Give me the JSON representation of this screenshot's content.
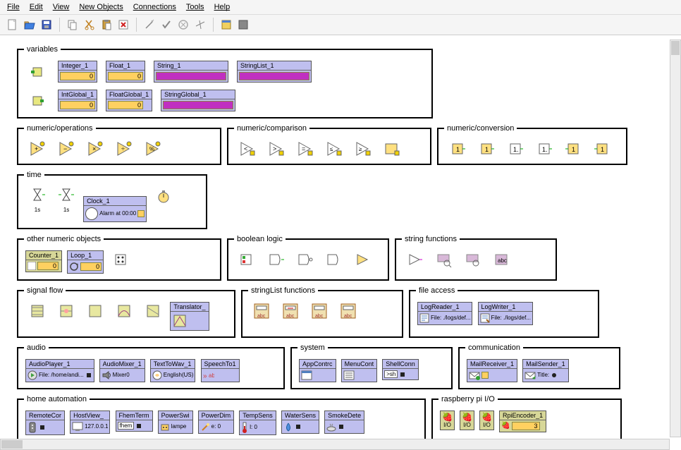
{
  "menu": {
    "file": "File",
    "edit": "Edit",
    "view": "View",
    "newobj": "New Objects",
    "conn": "Connections",
    "tools": "Tools",
    "help": "Help"
  },
  "groups": {
    "variables": "variables",
    "numops": "numeric/operations",
    "numcmp": "numeric/comparison",
    "numconv": "numeric/conversion",
    "time": "time",
    "othernum": "other numeric objects",
    "boollogic": "boolean logic",
    "stringfn": "string functions",
    "signalflow": "signal flow",
    "strlistfn": "stringList functions",
    "fileaccess": "file access",
    "audio": "audio",
    "system": "system",
    "comm": "communication",
    "homeauto": "home automation",
    "rpio": "raspberry pi I/O"
  },
  "v": {
    "integer": "Integer_1",
    "integer_v": "0",
    "float": "Float_1",
    "float_v": "0",
    "string": "String_1",
    "stringlist": "StringList_1",
    "intglobal": "IntGlobal_1",
    "intglobal_v": "0",
    "floatglobal": "FloatGlobal_1",
    "floatglobal_v": "0",
    "stringglobal": "StringGlobal_1"
  },
  "time": {
    "clock": "Clock_1",
    "alarm": "Alarm at 00:00",
    "onesec1": "1s",
    "onesec2": "1s"
  },
  "othernum": {
    "counter": "Counter_1",
    "counter_v": "0",
    "loop": "Loop_1",
    "loop_v": "0"
  },
  "signalflow": {
    "translator": "Translator_"
  },
  "fileaccess": {
    "logreader": "LogReader_1",
    "logreader_s": "File: ./logs/def...",
    "logwriter": "LogWriter_1",
    "logwriter_s": "File: ./logs/def..."
  },
  "audio": {
    "player": "AudioPlayer_1",
    "player_s": "File: /home/andi...",
    "mixer": "AudioMixer_1",
    "mixer_s": "Mixer0",
    "tts": "TextToWav_1",
    "tts_s": "English(US)",
    "stt": "SpeechTo1"
  },
  "system": {
    "app": "AppContrc",
    "menu": "MenuCont",
    "shell": "ShellConn",
    "shell_s": ">sh"
  },
  "comm": {
    "rx": "MailReceiver_1",
    "tx": "MailSender_1",
    "tx_s": "Title:"
  },
  "homeauto": {
    "remote": "RemoteCor",
    "hostview": "HostView_",
    "hostview_s": "127.0.0.1",
    "fhem": "FhemTerm",
    "fhem_s": "fhem",
    "powsw": "PowerSwi",
    "powsw_s": "lampe",
    "powdim": "PowerDim",
    "powdim_s": "e: 0",
    "temp": "TempSens",
    "temp_s": "l: 0",
    "water": "WaterSens",
    "smoke": "SmokeDete"
  },
  "rpio": {
    "io": "I/O",
    "encoder": "RpiEncoder_1",
    "encoder_v": "3"
  }
}
